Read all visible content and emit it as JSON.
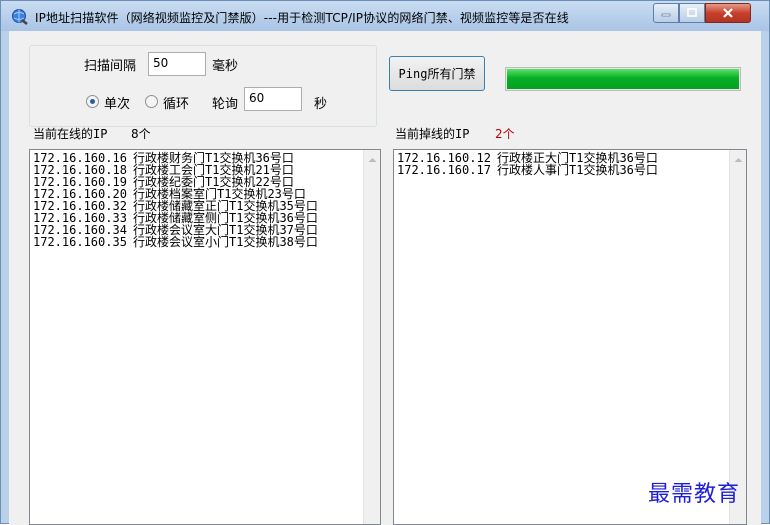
{
  "window": {
    "title": "IP地址扫描软件（网络视频监控及门禁版）---用于检测TCP/IP协议的网络门禁、视频监控等是否在线",
    "icon": "globe-icon"
  },
  "settings": {
    "interval_label": "扫描间隔",
    "interval_value": "50",
    "interval_unit": "毫秒",
    "mode_single_label": "单次",
    "mode_loop_label": "循环",
    "poll_label": "轮询",
    "poll_value": "60",
    "poll_unit": "秒",
    "selected_mode": "单次"
  },
  "ping_button_label": "Ping所有门禁",
  "progress": {
    "value_percent": 100,
    "color": "#06b025"
  },
  "online": {
    "label": "当前在线的IP",
    "count": "8个",
    "items": [
      {
        "ip": "172.16.160.16",
        "desc": "行政楼财务门T1交换机36号口"
      },
      {
        "ip": "172.16.160.18",
        "desc": "行政楼工会门T1交换机21号口"
      },
      {
        "ip": "172.16.160.19",
        "desc": "行政楼纪委门T1交换机22号口"
      },
      {
        "ip": "172.16.160.20",
        "desc": "行政楼档案室门T1交换机23号口"
      },
      {
        "ip": "172.16.160.32",
        "desc": "行政楼储藏室正门T1交换机35号口"
      },
      {
        "ip": "172.16.160.33",
        "desc": "行政楼储藏室侧门T1交换机36号口"
      },
      {
        "ip": "172.16.160.34",
        "desc": "行政楼会议室大门T1交换机37号口"
      },
      {
        "ip": "172.16.160.35",
        "desc": "行政楼会议室小门T1交换机38号口"
      }
    ]
  },
  "offline": {
    "label": "当前掉线的IP",
    "count": "2个",
    "count_color": "#c00000",
    "items": [
      {
        "ip": "172.16.160.12",
        "desc": "行政楼正大门T1交换机36号口"
      },
      {
        "ip": "172.16.160.17",
        "desc": "行政楼人事门T1交换机36号口"
      }
    ]
  },
  "watermark": "最需教育"
}
